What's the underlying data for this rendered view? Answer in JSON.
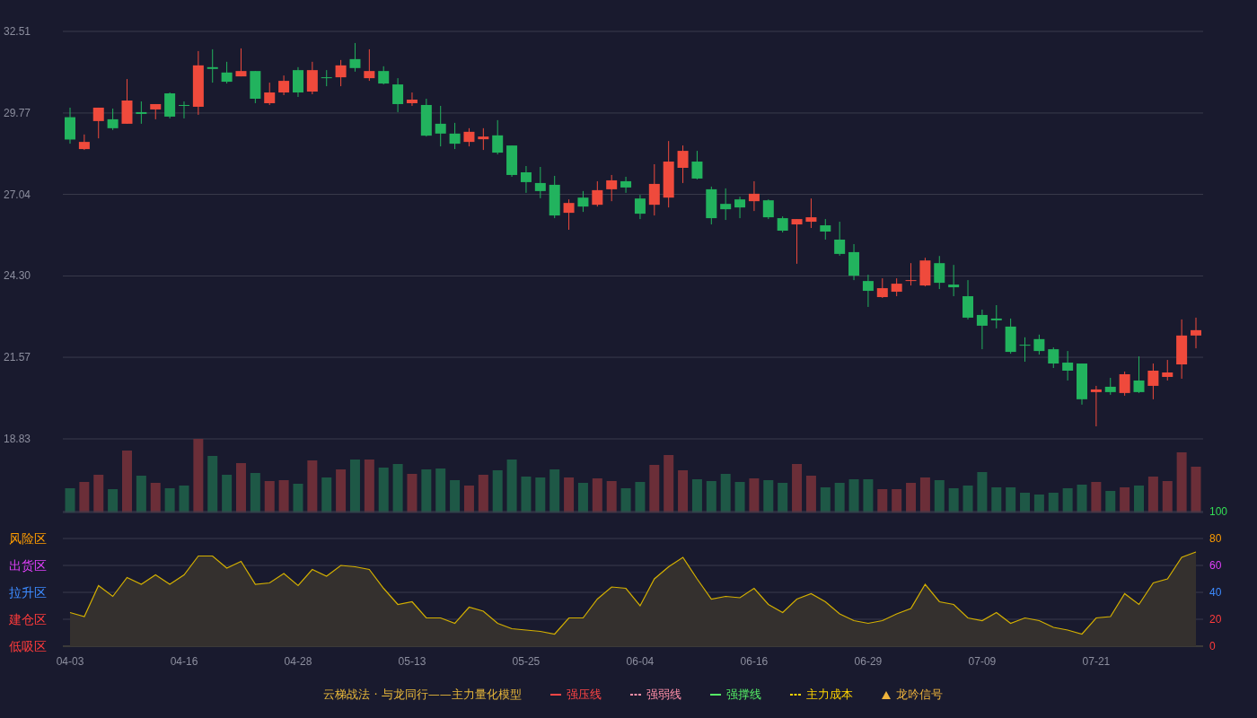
{
  "price_chart": {
    "chart_data": {
      "type": "candlestick",
      "grid": true,
      "categories": [
        null,
        null,
        null,
        null,
        null,
        null,
        null,
        null,
        null,
        null,
        null,
        null,
        null,
        null,
        null,
        null,
        null,
        null,
        null,
        null,
        null,
        null,
        null,
        null,
        null,
        null,
        null,
        null,
        null,
        null,
        null,
        null,
        null,
        null,
        null,
        null,
        null,
        null,
        null,
        null,
        null,
        null,
        null,
        null,
        null,
        null,
        null,
        null,
        null,
        null,
        null,
        null,
        null,
        null,
        null,
        null,
        null,
        null,
        null,
        null,
        null,
        null,
        null,
        null,
        null,
        null,
        null,
        null,
        null,
        null,
        null,
        null,
        null,
        null,
        null,
        null,
        null,
        null,
        null,
        null
      ],
      "ylim": [
        18.83,
        32.51
      ],
      "yticks": [
        {
          "value": 32.51,
          "label": "32.51"
        },
        {
          "value": 29.77,
          "label": "29.77"
        },
        {
          "value": 27.04,
          "label": "27.04"
        },
        {
          "value": 24.3,
          "label": "24.30"
        },
        {
          "value": 21.57,
          "label": "21.57"
        },
        {
          "value": 18.83,
          "label": "18.83"
        }
      ],
      "ohlc": [
        [
          29.63,
          29.95,
          28.74,
          28.88
        ],
        [
          28.56,
          29.05,
          28.53,
          28.8
        ],
        [
          29.5,
          29.95,
          28.92,
          29.95
        ],
        [
          29.56,
          29.92,
          29.2,
          29.26
        ],
        [
          29.41,
          30.91,
          29.41,
          30.19
        ],
        [
          29.8,
          30.16,
          29.41,
          29.74
        ],
        [
          29.89,
          30.07,
          29.56,
          30.07
        ],
        [
          30.43,
          30.46,
          29.59,
          29.65
        ],
        [
          30.04,
          30.16,
          29.59,
          30.01
        ],
        [
          29.98,
          31.85,
          29.71,
          31.37
        ],
        [
          31.31,
          31.91,
          30.79,
          31.25
        ],
        [
          31.13,
          31.49,
          30.76,
          30.82
        ],
        [
          31.0,
          31.94,
          31.0,
          31.18
        ],
        [
          31.18,
          31.18,
          30.1,
          30.25
        ],
        [
          30.1,
          30.79,
          30.04,
          30.46
        ],
        [
          30.46,
          31.03,
          30.37,
          30.85
        ],
        [
          31.21,
          31.31,
          30.31,
          30.46
        ],
        [
          30.49,
          31.49,
          30.4,
          31.21
        ],
        [
          30.97,
          31.21,
          30.67,
          30.94
        ],
        [
          30.97,
          31.55,
          30.67,
          31.37
        ],
        [
          31.58,
          32.12,
          31.16,
          31.28
        ],
        [
          30.94,
          31.91,
          30.85,
          31.18
        ],
        [
          31.18,
          31.34,
          30.73,
          30.76
        ],
        [
          30.73,
          30.94,
          29.8,
          30.07
        ],
        [
          30.1,
          30.46,
          30.01,
          30.22
        ],
        [
          30.04,
          30.25,
          28.98,
          29.01
        ],
        [
          29.41,
          30.01,
          28.65,
          29.08
        ],
        [
          29.08,
          29.44,
          28.56,
          28.74
        ],
        [
          28.8,
          29.26,
          28.65,
          29.14
        ],
        [
          28.89,
          29.26,
          28.53,
          28.98
        ],
        [
          29.02,
          29.53,
          28.38,
          28.44
        ],
        [
          28.68,
          28.68,
          27.63,
          27.69
        ],
        [
          27.78,
          27.99,
          27.09,
          27.45
        ],
        [
          27.42,
          27.96,
          26.91,
          27.15
        ],
        [
          27.36,
          27.66,
          26.24,
          26.33
        ],
        [
          26.42,
          26.87,
          25.85,
          26.75
        ],
        [
          26.93,
          27.15,
          26.45,
          26.63
        ],
        [
          26.69,
          27.48,
          26.63,
          27.18
        ],
        [
          27.21,
          27.69,
          26.81,
          27.51
        ],
        [
          27.48,
          27.63,
          27.09,
          27.27
        ],
        [
          26.9,
          27.02,
          26.21,
          26.39
        ],
        [
          26.69,
          28.05,
          26.33,
          27.39
        ],
        [
          26.93,
          28.83,
          26.6,
          28.14
        ],
        [
          27.93,
          28.68,
          27.42,
          28.5
        ],
        [
          28.14,
          28.5,
          27.54,
          27.57
        ],
        [
          27.21,
          27.3,
          26.03,
          26.24
        ],
        [
          26.72,
          27.24,
          26.18,
          26.54
        ],
        [
          26.87,
          26.96,
          26.24,
          26.6
        ],
        [
          26.81,
          27.48,
          26.48,
          27.06
        ],
        [
          26.84,
          26.87,
          26.21,
          26.27
        ],
        [
          26.24,
          26.3,
          25.76,
          25.82
        ],
        [
          26.03,
          26.21,
          24.71,
          26.21
        ],
        [
          26.12,
          26.9,
          25.91,
          26.27
        ],
        [
          26.0,
          26.21,
          25.52,
          25.79
        ],
        [
          25.52,
          26.12,
          24.98,
          25.04
        ],
        [
          25.1,
          25.37,
          24.16,
          24.31
        ],
        [
          24.13,
          24.34,
          23.26,
          23.8
        ],
        [
          23.59,
          24.22,
          23.56,
          23.89
        ],
        [
          23.77,
          24.22,
          23.62,
          24.04
        ],
        [
          24.13,
          24.73,
          23.98,
          24.16
        ],
        [
          23.98,
          24.91,
          23.95,
          24.82
        ],
        [
          24.73,
          24.97,
          23.86,
          24.07
        ],
        [
          24.01,
          24.67,
          23.62,
          23.92
        ],
        [
          23.62,
          24.16,
          22.84,
          22.9
        ],
        [
          22.99,
          23.17,
          21.84,
          22.63
        ],
        [
          22.87,
          23.32,
          22.54,
          22.81
        ],
        [
          22.6,
          22.87,
          21.69,
          21.75
        ],
        [
          21.99,
          22.24,
          21.42,
          21.96
        ],
        [
          22.18,
          22.33,
          21.66,
          21.78
        ],
        [
          21.84,
          21.9,
          21.21,
          21.36
        ],
        [
          21.39,
          21.78,
          20.79,
          21.12
        ],
        [
          21.36,
          21.36,
          19.98,
          20.16
        ],
        [
          20.4,
          20.61,
          19.25,
          20.49
        ],
        [
          20.58,
          20.88,
          20.31,
          20.4
        ],
        [
          20.37,
          21.09,
          20.28,
          21.0
        ],
        [
          20.79,
          21.6,
          20.37,
          20.4
        ],
        [
          20.61,
          21.36,
          20.16,
          21.12
        ],
        [
          20.91,
          21.48,
          20.79,
          21.06
        ],
        [
          21.33,
          22.84,
          20.85,
          22.3
        ],
        [
          22.3,
          22.9,
          21.87,
          22.48
        ]
      ]
    }
  },
  "indicator_chart": {
    "zones": [
      {
        "label": "风险区",
        "color": "#ff9d00"
      },
      {
        "label": "出货区",
        "color": "#e040fb"
      },
      {
        "label": "拉升区",
        "color": "#3d8bff"
      },
      {
        "label": "建仓区",
        "color": "#ff3b3b"
      },
      {
        "label": "低吸区",
        "color": "#ff3b3b"
      }
    ],
    "chart_data": {
      "type": "area",
      "grid": true,
      "ylim": [
        0,
        100
      ],
      "categories": [
        "04-03",
        null,
        null,
        null,
        null,
        null,
        null,
        null,
        "04-16",
        null,
        null,
        null,
        null,
        null,
        null,
        null,
        "04-28",
        null,
        null,
        null,
        null,
        null,
        null,
        null,
        "05-13",
        null,
        null,
        null,
        null,
        null,
        null,
        null,
        "05-25",
        null,
        null,
        null,
        null,
        null,
        null,
        null,
        "06-04",
        null,
        null,
        null,
        null,
        null,
        null,
        null,
        "06-16",
        null,
        null,
        null,
        null,
        null,
        null,
        null,
        "06-29",
        null,
        null,
        null,
        null,
        null,
        null,
        null,
        "07-09",
        null,
        null,
        null,
        null,
        null,
        null,
        null,
        "07-21",
        null,
        null,
        null,
        null,
        null,
        null,
        null
      ],
      "yticks": [
        100,
        80,
        60,
        40,
        20,
        0
      ],
      "series": [
        {
          "color": "#d4b000",
          "values": [
            25,
            22,
            45,
            37,
            51,
            46,
            53,
            46,
            53,
            67,
            67,
            58,
            63,
            46,
            47,
            54,
            45,
            57,
            52,
            60,
            59,
            57,
            43,
            31,
            33,
            21,
            21,
            17,
            29,
            26,
            17,
            13,
            12,
            11,
            9,
            21,
            21,
            35,
            44,
            43,
            30,
            50,
            59,
            66,
            50,
            35,
            37,
            36,
            43,
            31,
            25,
            35,
            39,
            33,
            24,
            19,
            17,
            19,
            24,
            28,
            46,
            33,
            31,
            21,
            19,
            25,
            17,
            21,
            19,
            14,
            12,
            9,
            21,
            22,
            39,
            31,
            47,
            50,
            66,
            70
          ]
        }
      ]
    }
  },
  "legend": {
    "title": "云梯战法 · 与龙同行——主力量化模型",
    "items": [
      {
        "label": "强压线",
        "kind": "solid",
        "color": "#ff4545"
      },
      {
        "label": "强弱线",
        "kind": "dashed",
        "color": "#ff8fa8"
      },
      {
        "label": "强撑线",
        "kind": "solid",
        "color": "#55ee66"
      },
      {
        "label": "主力成本",
        "kind": "dashed",
        "color": "#ffd400"
      },
      {
        "label": "龙吟信号",
        "kind": "triangle",
        "color": "#f0b43c"
      }
    ]
  }
}
